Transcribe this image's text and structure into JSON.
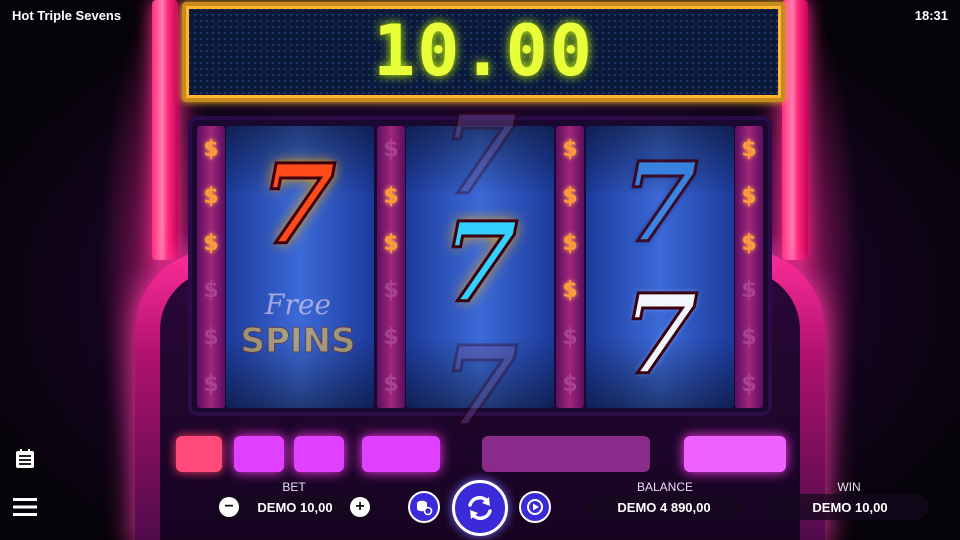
{
  "app": {
    "title": "Hot Triple Sevens",
    "time": "18:31"
  },
  "display": {
    "value": "10.00"
  },
  "reels": [
    {
      "symbols": [
        "seven-red-hot",
        "free-spins"
      ]
    },
    {
      "symbols": [
        "seven-ghost",
        "seven-blue-hot",
        "seven-ghost"
      ]
    },
    {
      "symbols": [
        "seven-blue",
        "seven-white"
      ]
    }
  ],
  "free_spins": {
    "line1": "Free",
    "line2": "SPINS"
  },
  "reel_strip_glyph": "$",
  "controls": {
    "bet_label": "BET",
    "bet_value": "DEMO 10,00",
    "balance_label": "BALANCE",
    "balance_value": "DEMO 4 890,00",
    "win_label": "WIN",
    "win_value": "DEMO 10,00",
    "minus": "−",
    "plus": "+"
  },
  "colors": {
    "accent_pink": "#ff2d9a",
    "display_text": "#e8ff3a",
    "spin_blue": "#3a2ad8"
  }
}
